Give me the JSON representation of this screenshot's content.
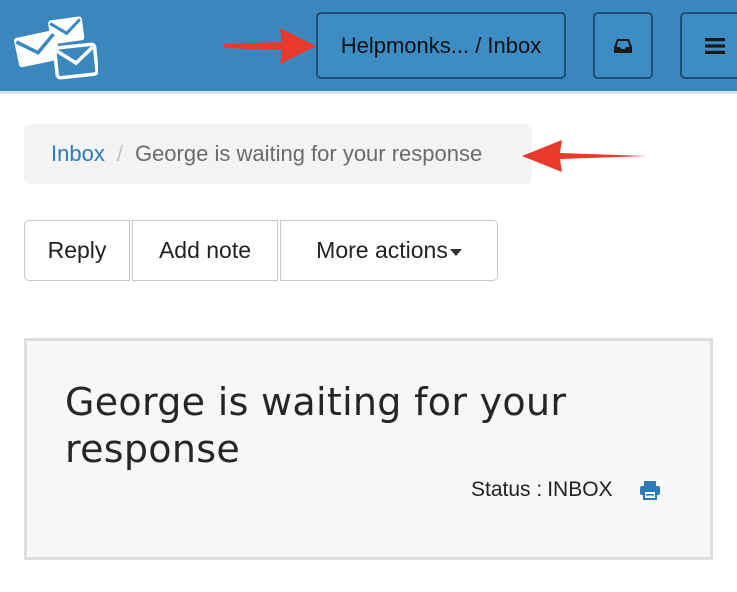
{
  "header": {
    "mailbox_label": "Helpmonks... / Inbox",
    "inbox_icon": "inbox-tray-icon",
    "menu_icon": "hamburger-menu-icon",
    "colors": {
      "bar": "#3a87be",
      "arrow": "#e8392a"
    }
  },
  "breadcrumb": {
    "link": "Inbox",
    "separator": "/",
    "current": "George is waiting for your response"
  },
  "actions": {
    "reply": "Reply",
    "add_note": "Add note",
    "more": "More actions"
  },
  "ticket": {
    "title": "George is waiting for your response",
    "status_label": "Status :",
    "status_value": "INBOX",
    "print_icon": "print-icon"
  }
}
